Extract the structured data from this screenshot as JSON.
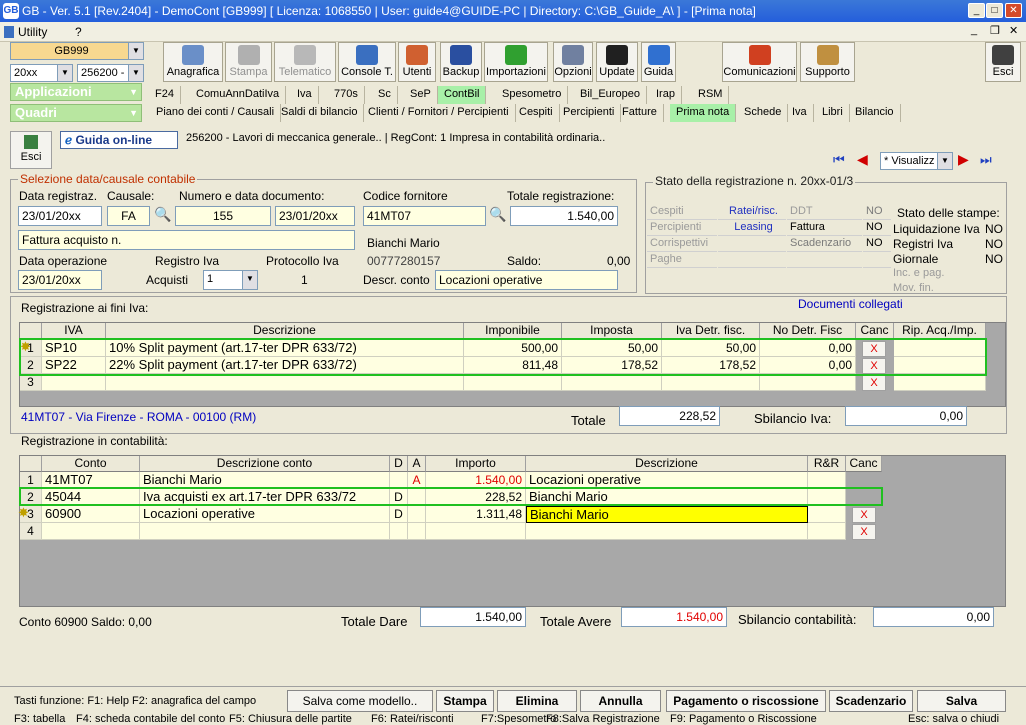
{
  "window": {
    "title": "GB - Ver. 5.1 [Rev.2404] - DemoCont [GB999]   [ Licenza: 1068550 | User: guide4@GUIDE-PC | Directory: C:\\GB_Guide_A\\ ] - [Prima nota]",
    "app_icon": "GB"
  },
  "menu": {
    "items": [
      "Utility",
      "?"
    ]
  },
  "selectors": {
    "company": "GB999",
    "year": "20xx",
    "firm": "256200 -"
  },
  "toolbar": [
    {
      "label": "Anagrafica",
      "icon": "address-book-icon",
      "color": "#6a8fc8"
    },
    {
      "label": "Stampa",
      "icon": "printer-icon",
      "color": "#b0b0b0"
    },
    {
      "label": "Telematico",
      "icon": "feather-icon",
      "color": "#b8b8b8"
    },
    {
      "label": "Console T.",
      "icon": "console-icon",
      "color": "#3a6fc0"
    },
    {
      "label": "Utenti",
      "icon": "users-icon",
      "color": "#d06030"
    },
    {
      "label": "Backup",
      "icon": "backup-icon",
      "color": "#2a4fa0"
    },
    {
      "label": "Importazioni",
      "icon": "import-icon",
      "color": "#30a030"
    },
    {
      "label": "Opzioni",
      "icon": "wrench-icon",
      "color": "#7080a0"
    },
    {
      "label": "Update",
      "icon": "update-icon",
      "color": "#202020"
    },
    {
      "label": "Guida",
      "icon": "help-icon",
      "color": "#3070d0"
    },
    {
      "label": "Comunicazioni",
      "icon": "communications-icon",
      "color": "#d04020"
    },
    {
      "label": "Supporto",
      "icon": "support-icon",
      "color": "#c09040"
    },
    {
      "label": "Esci",
      "icon": "exit-icon",
      "color": "#404040"
    }
  ],
  "sections": {
    "applicazioni": "Applicazioni",
    "quadri": "Quadri"
  },
  "tabs_row1": [
    "F24",
    "ComuAnnDatiIva",
    "Iva",
    "770s",
    "Sc",
    "SeP",
    "ContBil",
    "Spesometro",
    "Bil_Europeo",
    "Irap",
    "RSM"
  ],
  "tabs_row1_selected": "ContBil",
  "tabs_row2": [
    "Piano dei conti / Causali",
    "Saldi di bilancio",
    "Clienti / Fornitori / Percipienti",
    "Cespiti",
    "Percipienti",
    "Fatture",
    "Prima nota",
    "Schede",
    "Iva",
    "Libri",
    "Bilancio"
  ],
  "tabs_row2_selected": "Prima nota",
  "header": {
    "esci": "Esci",
    "guida": "Guida on-line",
    "info": "256200 - Lavori di meccanica generale..  | RegCont: 1 Impresa  in contabilità ordinaria..",
    "view_mode": "* Visualizz"
  },
  "selezione": {
    "title": "Selezione data/causale contabile",
    "data_reg_label": "Data registraz.",
    "data_reg": "23/01/20xx",
    "causale_label": "Causale:",
    "causale": "FA",
    "numdoc_label": "Numero e data documento:",
    "numero": "155",
    "data_doc": "23/01/20xx",
    "descr": "Fattura acquisto n.",
    "data_op_label": "Data operazione",
    "data_op": "23/01/20xx",
    "registro_label": "Registro Iva",
    "registro": "Acquisti",
    "registro_num": "1",
    "protocollo_label": "Protocollo Iva",
    "protocollo": "1",
    "fornitore_label": "Codice fornitore",
    "fornitore": "41MT07",
    "totale_label": "Totale registrazione:",
    "totale": "1.540,00",
    "nome": "Bianchi Mario",
    "piva": "00777280157",
    "saldo_label": "Saldo:",
    "saldo": "0,00",
    "descr_conto_label": "Descr. conto",
    "descr_conto": "Locazioni operative"
  },
  "stato": {
    "title": "Stato della registrazione n. 20xx-01/3",
    "rows": [
      {
        "a": "Cespiti",
        "b": "Ratei/risc.",
        "c": "DDT",
        "d": "NO"
      },
      {
        "a": "Percipienti",
        "b": "Leasing",
        "c": "Fattura",
        "d": "NO"
      },
      {
        "a": "Corrispettivi",
        "b": "",
        "c": "Scadenzario",
        "d": "NO"
      },
      {
        "a": "Paghe",
        "b": "",
        "c": "",
        "d": ""
      }
    ],
    "stampe_title": "Stato delle stampe:",
    "stampe": [
      {
        "k": "Liquidazione Iva",
        "v": "NO"
      },
      {
        "k": "Registri Iva",
        "v": "NO"
      },
      {
        "k": "Giornale",
        "v": "NO"
      },
      {
        "k": "Inc. e pag.",
        "v": ""
      },
      {
        "k": "Mov. fin.",
        "v": ""
      }
    ]
  },
  "iva": {
    "title": "Registrazione ai fini Iva:",
    "documenti": "Documenti collegati",
    "headers": [
      "IVA",
      "Descrizione",
      "Imponibile",
      "Imposta",
      "Iva Detr. fisc.",
      "No Detr. Fisc",
      "Canc",
      "Rip. Acq./Imp."
    ],
    "rows": [
      {
        "n": "1",
        "iva": "SP10",
        "descr": "10% Split payment (art.17-ter DPR 633/72)",
        "imponibile": "500,00",
        "imposta": "50,00",
        "detr": "50,00",
        "nodetr": "0,00",
        "canc": "X"
      },
      {
        "n": "2",
        "iva": "SP22",
        "descr": "22% Split payment (art.17-ter DPR 633/72)",
        "imponibile": "811,48",
        "imposta": "178,52",
        "detr": "178,52",
        "nodetr": "0,00",
        "canc": "X"
      },
      {
        "n": "3",
        "iva": "",
        "descr": "",
        "imponibile": "",
        "imposta": "",
        "detr": "",
        "nodetr": "",
        "canc": "X"
      }
    ],
    "address": "41MT07 - Via Firenze - ROMA - 00100 (RM)",
    "totale_label": "Totale",
    "totale": "228,52",
    "sbilancio_label": "Sbilancio Iva:",
    "sbilancio": "0,00"
  },
  "contabilita": {
    "title": "Registrazione in contabilità:",
    "headers": [
      "Conto",
      "Descrizione conto",
      "D",
      "A",
      "Importo",
      "Descrizione",
      "R&R",
      "Canc"
    ],
    "rows": [
      {
        "n": "1",
        "conto": "41MT07",
        "descr_conto": "Bianchi Mario",
        "d": "",
        "a": "A",
        "importo": "1.540,00",
        "descr": "Locazioni operative",
        "canc": ""
      },
      {
        "n": "2",
        "conto": "45044",
        "descr_conto": "Iva acquisti ex art.17-ter DPR 633/72",
        "d": "D",
        "a": "",
        "importo": "228,52",
        "descr": "Bianchi Mario",
        "canc": ""
      },
      {
        "n": "3",
        "conto": "60900",
        "descr_conto": "Locazioni operative",
        "d": "D",
        "a": "",
        "importo": "1.311,48",
        "descr": "Bianchi Mario",
        "canc": "X"
      },
      {
        "n": "4",
        "conto": "",
        "descr_conto": "",
        "d": "",
        "a": "",
        "importo": "",
        "descr": "",
        "canc": "X"
      }
    ],
    "saldo_info": "Conto 60900 Saldo: 0,00",
    "dare_label": "Totale Dare",
    "dare": "1.540,00",
    "avere_label": "Totale Avere",
    "avere": "1.540,00",
    "sbil_label": "Sbilancio contabilità:",
    "sbil": "0,00"
  },
  "bottom": {
    "tasti": "Tasti funzione:  F1: Help  F2: anagrafica del campo",
    "buttons": [
      "Salva come modello..",
      "Stampa",
      "Elimina",
      "Annulla",
      "Pagamento o riscossione",
      "Scadenzario",
      "Salva"
    ],
    "status": [
      "F3: tabella",
      "F4: scheda contabile del conto",
      "F5: Chiusura delle partite",
      "F6: Ratei/risconti",
      "F7:Spesometro",
      "F8:Salva Registrazione",
      "F9: Pagamento o Riscossione",
      "Esc: salva o chiudi"
    ]
  },
  "colors": {
    "accent_green": "#a8f0a8",
    "highlight_yellow": "#ffff00",
    "red": "#e00000",
    "blue_text": "#0000c0"
  }
}
